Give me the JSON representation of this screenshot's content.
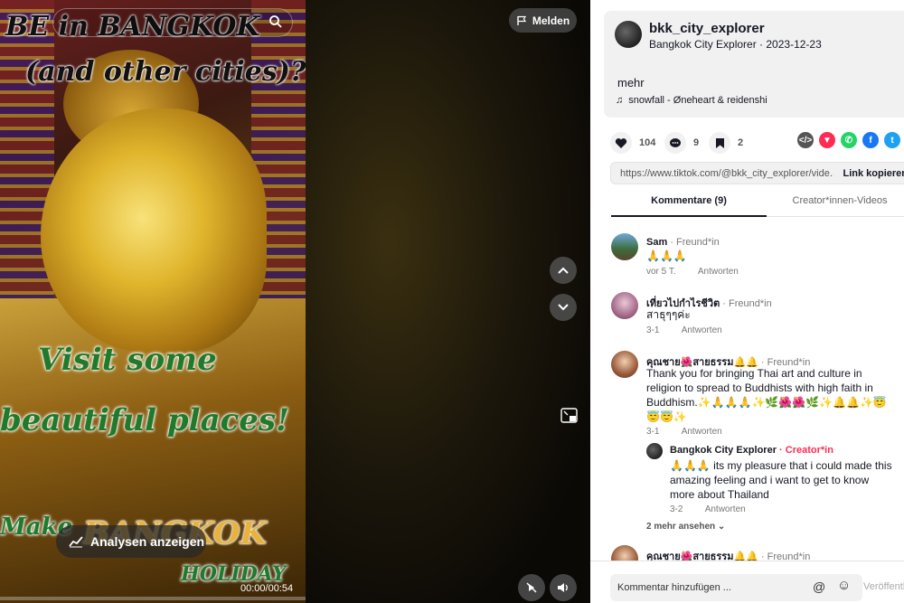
{
  "video": {
    "report_label": "Melden",
    "analysis_label": "Analysen anzeigen",
    "time": "00:00/00:54",
    "overlay": {
      "line1": "BE in BANGKOK",
      "line2": "(and other cities)?",
      "line3": "Visit some",
      "line4": "beautiful places!",
      "line5": "Make",
      "line6": "BANGKOK",
      "line7": "HOLIDAY"
    }
  },
  "post": {
    "username": "bkk_city_explorer",
    "subtitle": "Bangkok City Explorer · 2023-12-23",
    "more": "mehr",
    "music": "snowfall - Øneheart & reidenshi",
    "likes": "104",
    "comments": "9",
    "saves": "2",
    "link_url": "https://www.tiktok.com/@bkk_city_explorer/vide...",
    "link_copy": "Link kopieren"
  },
  "tabs": {
    "comments": "Kommentare (9)",
    "creator": "Creator*innen-Videos"
  },
  "comments": [
    {
      "name": "Sam",
      "badge": "· Freund*in",
      "text": "🙏🙏🙏",
      "date": "vor 5 T.",
      "reply": "Antworten"
    },
    {
      "name": "เที่ยวไปกำไรชีวิต",
      "badge": "· Freund*in",
      "text": "สาธุๆๆค่ะ",
      "date": "3-1",
      "reply": "Antworten"
    },
    {
      "name": "คุณชาย🌺สายธรรม🔔🔔",
      "badge": "· Freund*in",
      "text": "Thank you for bringing Thai art and culture in religion to spread to Buddhists with high faith in Buddhism.✨🙏🙏🙏✨🌿🌺🌺🌿✨🔔🔔✨😇😇😇✨",
      "date": "3-1",
      "reply": "Antworten"
    },
    {
      "name": "Bangkok City Explorer",
      "badge": "· Creator*in",
      "text": "🙏🙏🙏 its my pleasure that i could made this amazing feeling and i want to get to know more about Thailand",
      "date": "3-2",
      "reply": "Antworten"
    },
    {
      "name": "คุณชาย🌺สายธรรม🔔🔔",
      "badge": "· Freund*in"
    }
  ],
  "more_replies": "2 mehr ansehen ⌄",
  "input": {
    "placeholder": "Kommentar hinzufügen ...",
    "publish": "Veröffentl"
  },
  "colors": {
    "accent": "#fe2c55",
    "panel_bg": "#ffffff",
    "card_bg": "#f1f1f2"
  }
}
